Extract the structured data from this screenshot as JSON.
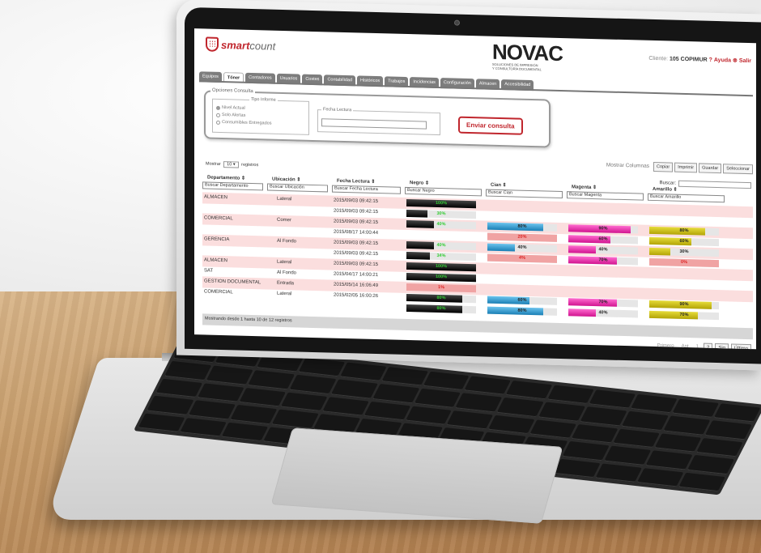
{
  "app": {
    "logo": {
      "brand_bold": "smart",
      "brand_light": "count"
    },
    "novac": {
      "title": "NOVAC",
      "subtitle_1": "SOLUCIONES DE IMPRESIÓN",
      "subtitle_2": "Y CONSULTORÍA DOCUMENTAL"
    },
    "client": {
      "label": "Cliente:",
      "value": "105 COPIMUR",
      "help": "Ayuda",
      "exit": "Salir"
    },
    "tabs": [
      "Equipos",
      "Tóner",
      "Contadores",
      "Usuarios",
      "Costes",
      "Contabilidad",
      "Históricos",
      "Trabajos",
      "Incidencias",
      "Configuración",
      "Almacen",
      "Accesibilidad"
    ],
    "active_tab": "Tóner",
    "options": {
      "legend": "Opciones Consulta",
      "tipo_legend": "Tipo Informe",
      "radios": [
        "Nivel Actual",
        "Solo Alertas",
        "Consumibles Entregados"
      ],
      "fecha_legend": "Fecha Lectura",
      "submit": "Enviar consulta"
    },
    "column_buttons": [
      "Mostrar Columnas",
      "Copiar",
      "Imprimir",
      "Guardar",
      "Seleccionar"
    ],
    "length": {
      "prefix": "Mostrar",
      "value": "10",
      "suffix": "registros"
    },
    "search_label": "Buscar:",
    "headers": [
      "Departamento",
      "Ubicación",
      "Fecha Lectura",
      "Negro",
      "Cian",
      "Magenta",
      "Amarillo"
    ],
    "search_placeholders": [
      "Buscar Departamento",
      "Buscar Ubicación",
      "Buscar Fecha Lectura",
      "Buscar Negro",
      "Buscar Cian",
      "Buscar Magenta",
      "Buscar Amarillo"
    ],
    "rows": [
      {
        "dept": "ALMACEN",
        "loc": "Lateral",
        "date": "2015/09/03 09:42:15",
        "k": "100%",
        "c": "",
        "m": "",
        "y": ""
      },
      {
        "dept": "",
        "loc": "",
        "date": "2015/09/03 09:42:15",
        "k": "30%",
        "c": "",
        "m": "",
        "y": ""
      },
      {
        "dept": "COMERCIAL",
        "loc": "Comer",
        "date": "2015/09/03 09:42:15",
        "k": "40%",
        "c": "80%",
        "m": "90%",
        "y": "80%"
      },
      {
        "dept": "",
        "loc": "",
        "date": "2015/08/17 14:00:44",
        "k": "",
        "c": "20%",
        "m": "60%",
        "y": "60%"
      },
      {
        "dept": "GERENCIA",
        "loc": "Al Fondo",
        "date": "2015/09/03 09:42:15",
        "k": "40%",
        "c": "40%",
        "m": "40%",
        "y": "30%"
      },
      {
        "dept": "",
        "loc": "",
        "date": "2015/09/03 09:42:15",
        "k": "34%",
        "c": "4%",
        "m": "70%",
        "y": "0%"
      },
      {
        "dept": "ALMACEN",
        "loc": "Lateral",
        "date": "2015/09/03 09:42:15",
        "k": "100%",
        "c": "",
        "m": "",
        "y": ""
      },
      {
        "dept": "SAT",
        "loc": "Al Fondo",
        "date": "2015/04/17 14:00:21",
        "k": "100%",
        "c": "",
        "m": "",
        "y": ""
      },
      {
        "dept": "GESTION DOCUMENTAL",
        "loc": "Entrada",
        "date": "2015/05/14 16:06:49",
        "k": "1%",
        "c": "",
        "m": "",
        "y": ""
      },
      {
        "dept": "COMERCIAL",
        "loc": "Lateral",
        "date": "2015/02/05 16:00:26",
        "k": "80%",
        "c": "60%",
        "m": "70%",
        "y": "90%"
      },
      {
        "dept": "",
        "loc": "",
        "date": "",
        "k": "80%",
        "c": "80%",
        "m": "40%",
        "y": "70%"
      }
    ],
    "footer": "Mostrando desde 1 hasta 10 de 12 registros",
    "pager": [
      "Primero",
      "Ant",
      "1",
      "2",
      "Sig",
      "Último"
    ]
  }
}
